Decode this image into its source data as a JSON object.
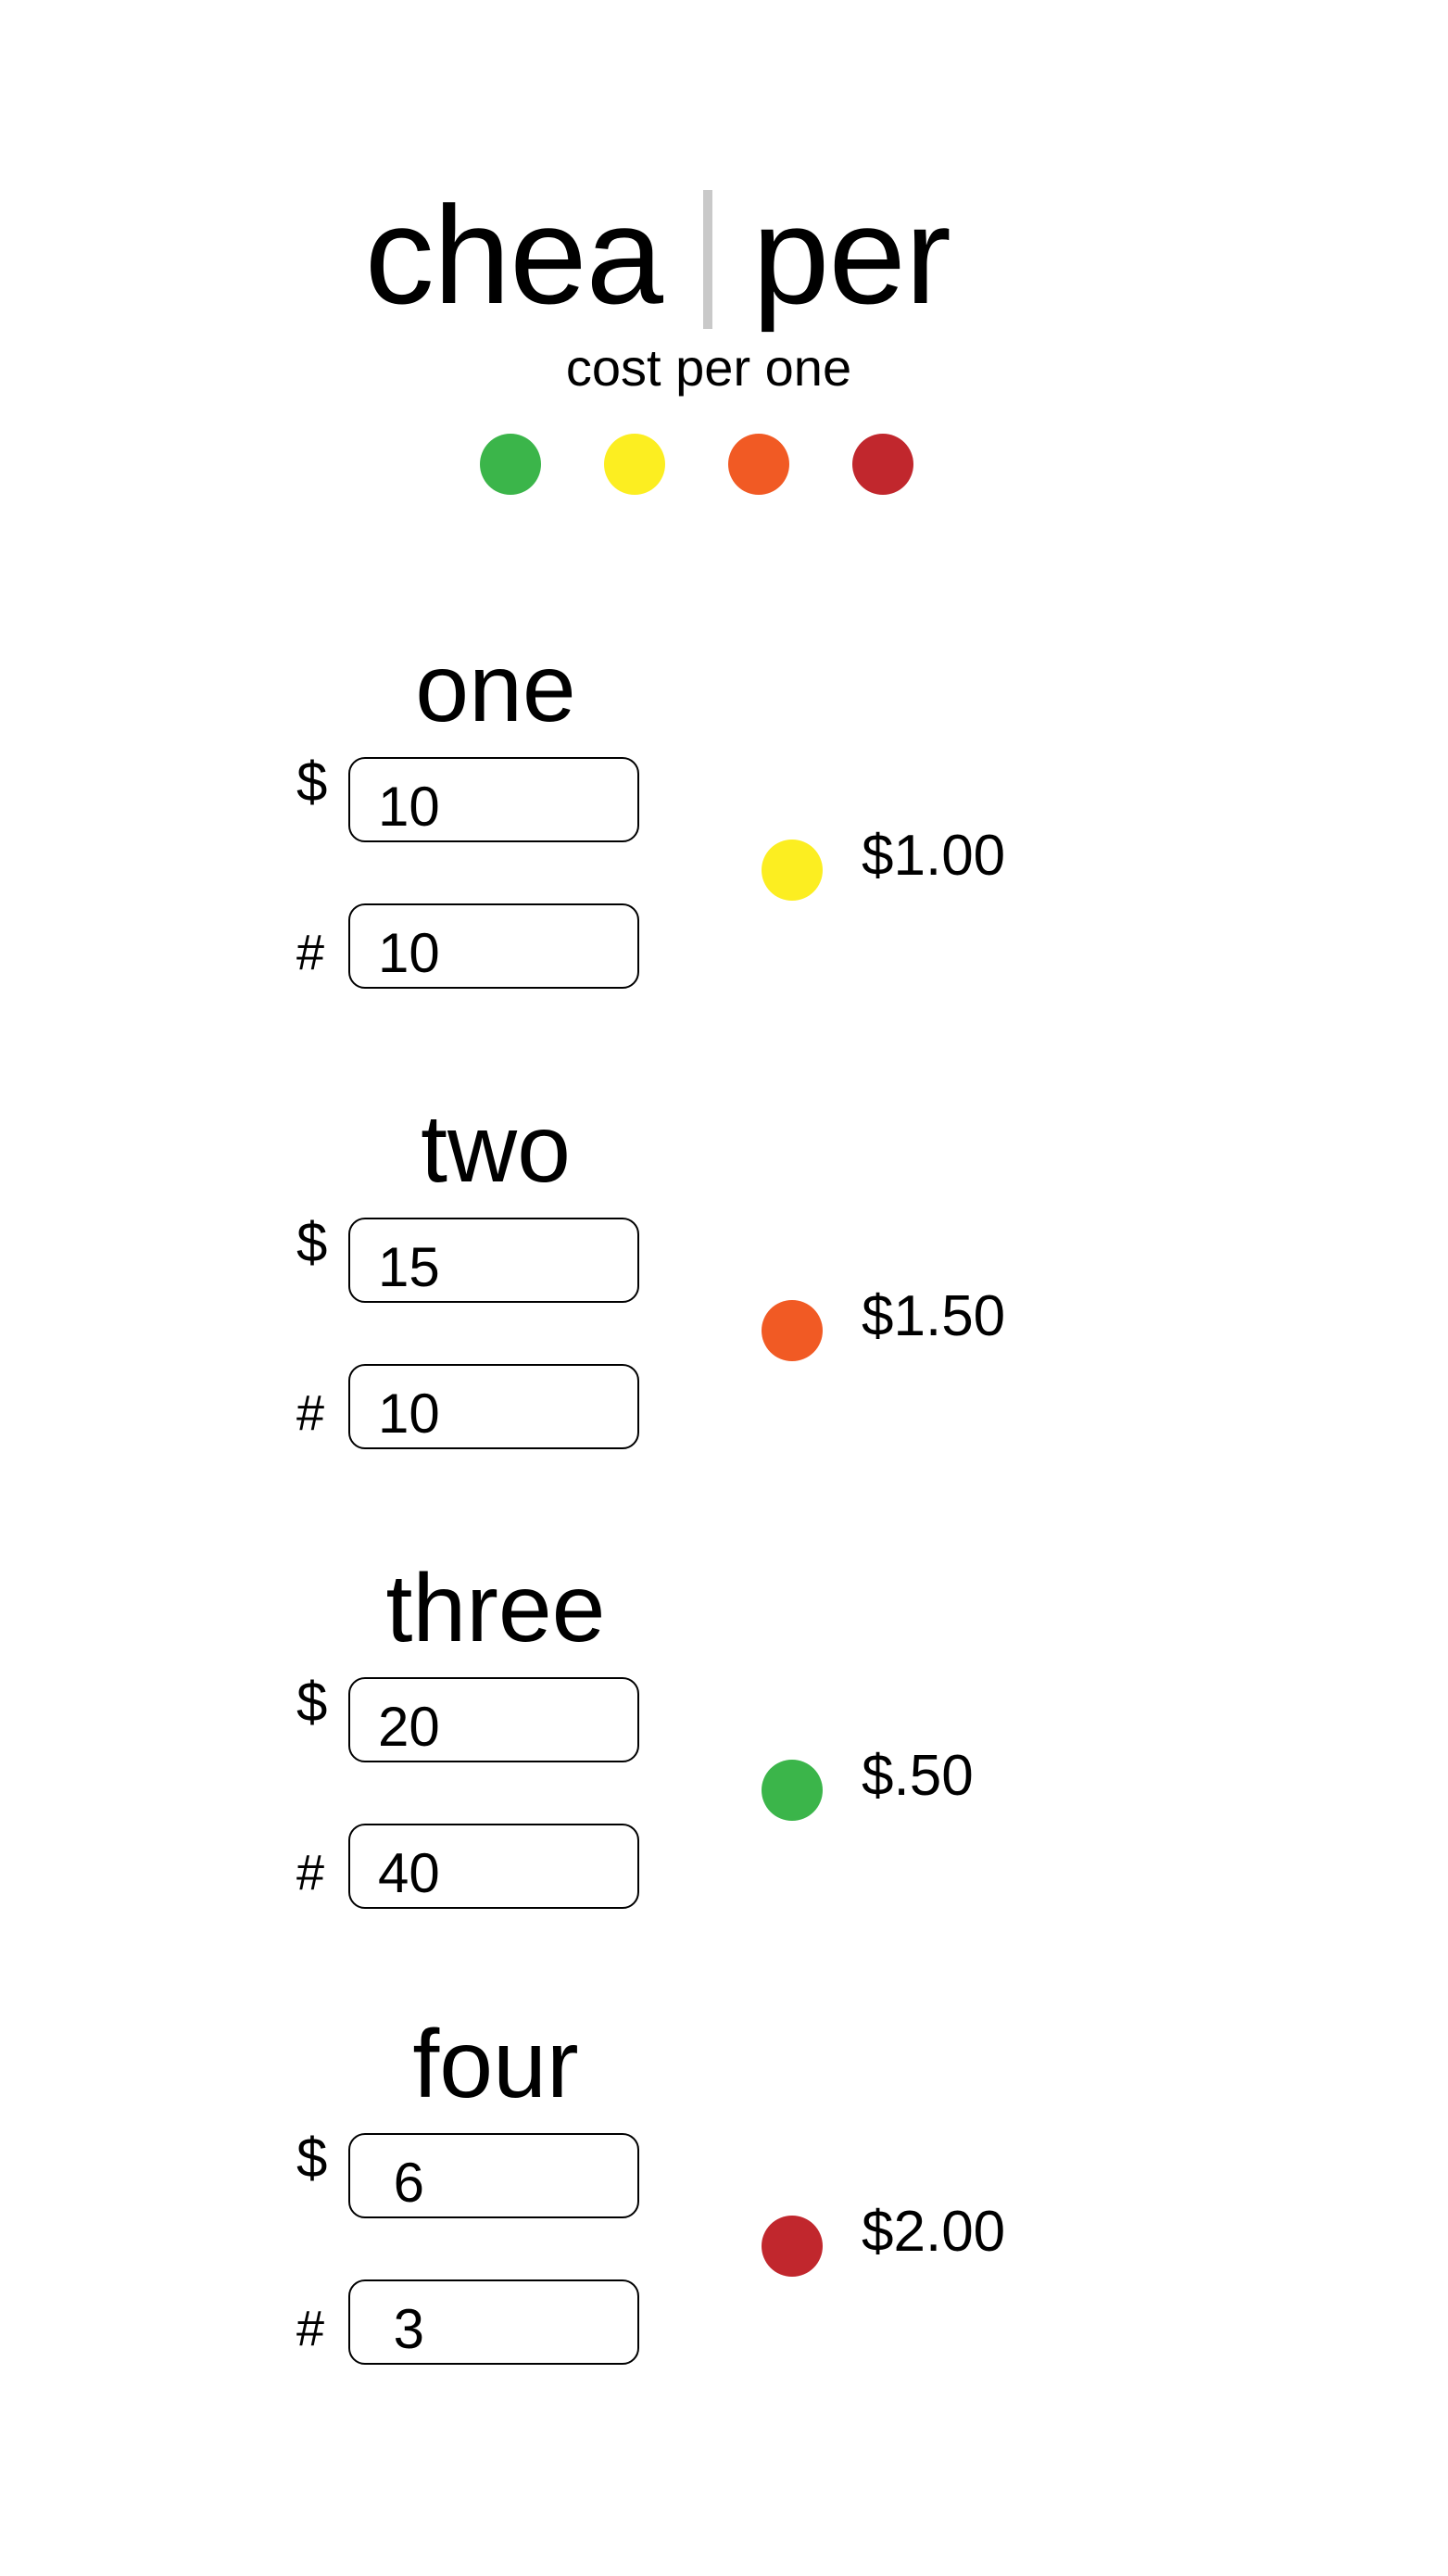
{
  "header": {
    "logo_left": "chea",
    "logo_right": "per",
    "tagline": "cost per one",
    "legend_colors": [
      "#3bb54a",
      "#fcee21",
      "#f15a24",
      "#c1272d"
    ]
  },
  "items": [
    {
      "title": "one",
      "price_symbol": "$",
      "qty_symbol": "#",
      "price": "10",
      "qty": "10",
      "cost": "$1.00",
      "color": "#fcee21"
    },
    {
      "title": "two",
      "price_symbol": "$",
      "qty_symbol": "#",
      "price": "15",
      "qty": "10",
      "cost": "$1.50",
      "color": "#f15a24"
    },
    {
      "title": "three",
      "price_symbol": "$",
      "qty_symbol": "#",
      "price": "20",
      "qty": "40",
      "cost": "$.50",
      "color": "#3bb54a"
    },
    {
      "title": "four",
      "price_symbol": "$",
      "qty_symbol": "#",
      "price": " 6",
      "qty": " 3",
      "cost": "$2.00",
      "color": "#c1272d"
    }
  ]
}
